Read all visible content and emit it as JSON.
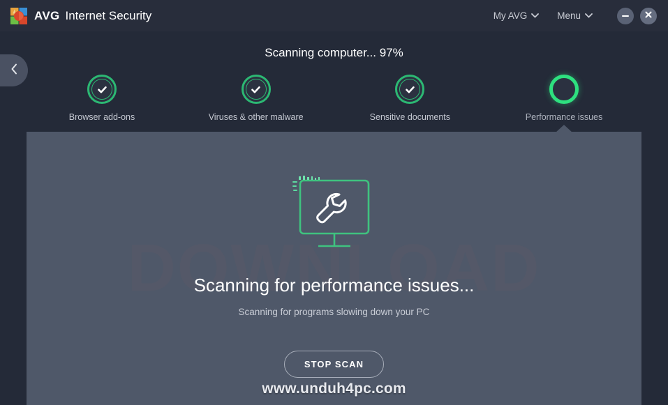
{
  "window": {
    "brand_name": "AVG",
    "product_name": "Internet Security",
    "logo_icon": "avg-logo-icon",
    "my_avg_label": "My AVG",
    "menu_label": "Menu",
    "minimize_icon": "minimize-icon",
    "close_icon": "close-icon",
    "chevron_down_icon": "chevron-down-icon"
  },
  "navigation": {
    "back_icon": "chevron-left-icon"
  },
  "scan": {
    "status_text": "Scanning computer... 97%",
    "progress_percent": 97,
    "steps": [
      {
        "label": "Browser add-ons",
        "state": "done"
      },
      {
        "label": "Viruses & other malware",
        "state": "done"
      },
      {
        "label": "Sensitive documents",
        "state": "done"
      },
      {
        "label": "Performance issues",
        "state": "active"
      }
    ],
    "check_icon": "check-icon"
  },
  "panel": {
    "illustration_icon": "monitor-wrench-icon",
    "title": "Scanning for performance issues...",
    "subtitle": "Scanning for programs slowing down your PC",
    "stop_button_label": "STOP SCAN",
    "watermark_text": "www.unduh4pc.com",
    "background_watermark": "DOWNLOAD"
  },
  "colors": {
    "accent_green": "#2cb873",
    "active_green": "#2ee07f",
    "titlebar_bg": "#282d3b",
    "body_bg": "#242a38",
    "panel_bg": "#4f5869",
    "track_gray": "#5d6575"
  }
}
